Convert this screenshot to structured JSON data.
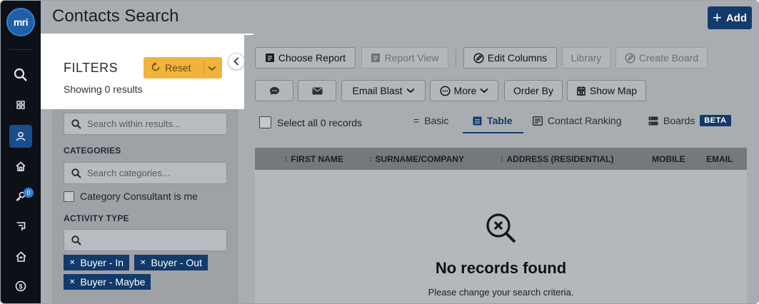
{
  "app": {
    "logo_text": "mri"
  },
  "header": {
    "title": "Contacts Search",
    "add_label": "Add"
  },
  "rail": {
    "icons": [
      "search-icon",
      "grid-icon",
      "contacts-icon",
      "home-icon",
      "key-icon",
      "listing-icon",
      "property-icon",
      "dollar-icon"
    ],
    "badge_count": "0"
  },
  "filters": {
    "title": "FILTERS",
    "reset_label": "Reset",
    "showing_text": "Showing 0 results",
    "search_placeholder": "Search within results...",
    "categories_label": "CATEGORIES",
    "categories_placeholder": "Search categories...",
    "category_consultant_label": "Category Consultant is me",
    "activity_type_label": "ACTIVITY TYPE",
    "activity_tags": [
      "Buyer - In",
      "Buyer - Out",
      "Buyer - Maybe"
    ]
  },
  "toolbar": {
    "choose_report": "Choose Report",
    "report_view": "Report View",
    "edit_columns": "Edit Columns",
    "library": "Library",
    "create_board": "Create Board",
    "email_blast": "Email Blast",
    "more": "More",
    "order_by": "Order By",
    "show_map": "Show Map"
  },
  "select_all_label": "Select all 0 records",
  "view_tabs": {
    "basic": "Basic",
    "table": "Table",
    "contact_ranking": "Contact Ranking",
    "boards": "Boards",
    "beta": "BETA",
    "active": "Table"
  },
  "table": {
    "columns": [
      "FIRST NAME",
      "SURNAME/COMPANY",
      "ADDRESS (RESIDENTIAL)",
      "MOBILE",
      "EMAIL"
    ]
  },
  "empty_state": {
    "title": "No records found",
    "subtitle": "Please change your search criteria."
  },
  "colors": {
    "brand": "#123a6b",
    "reset": "#f0b43c"
  }
}
